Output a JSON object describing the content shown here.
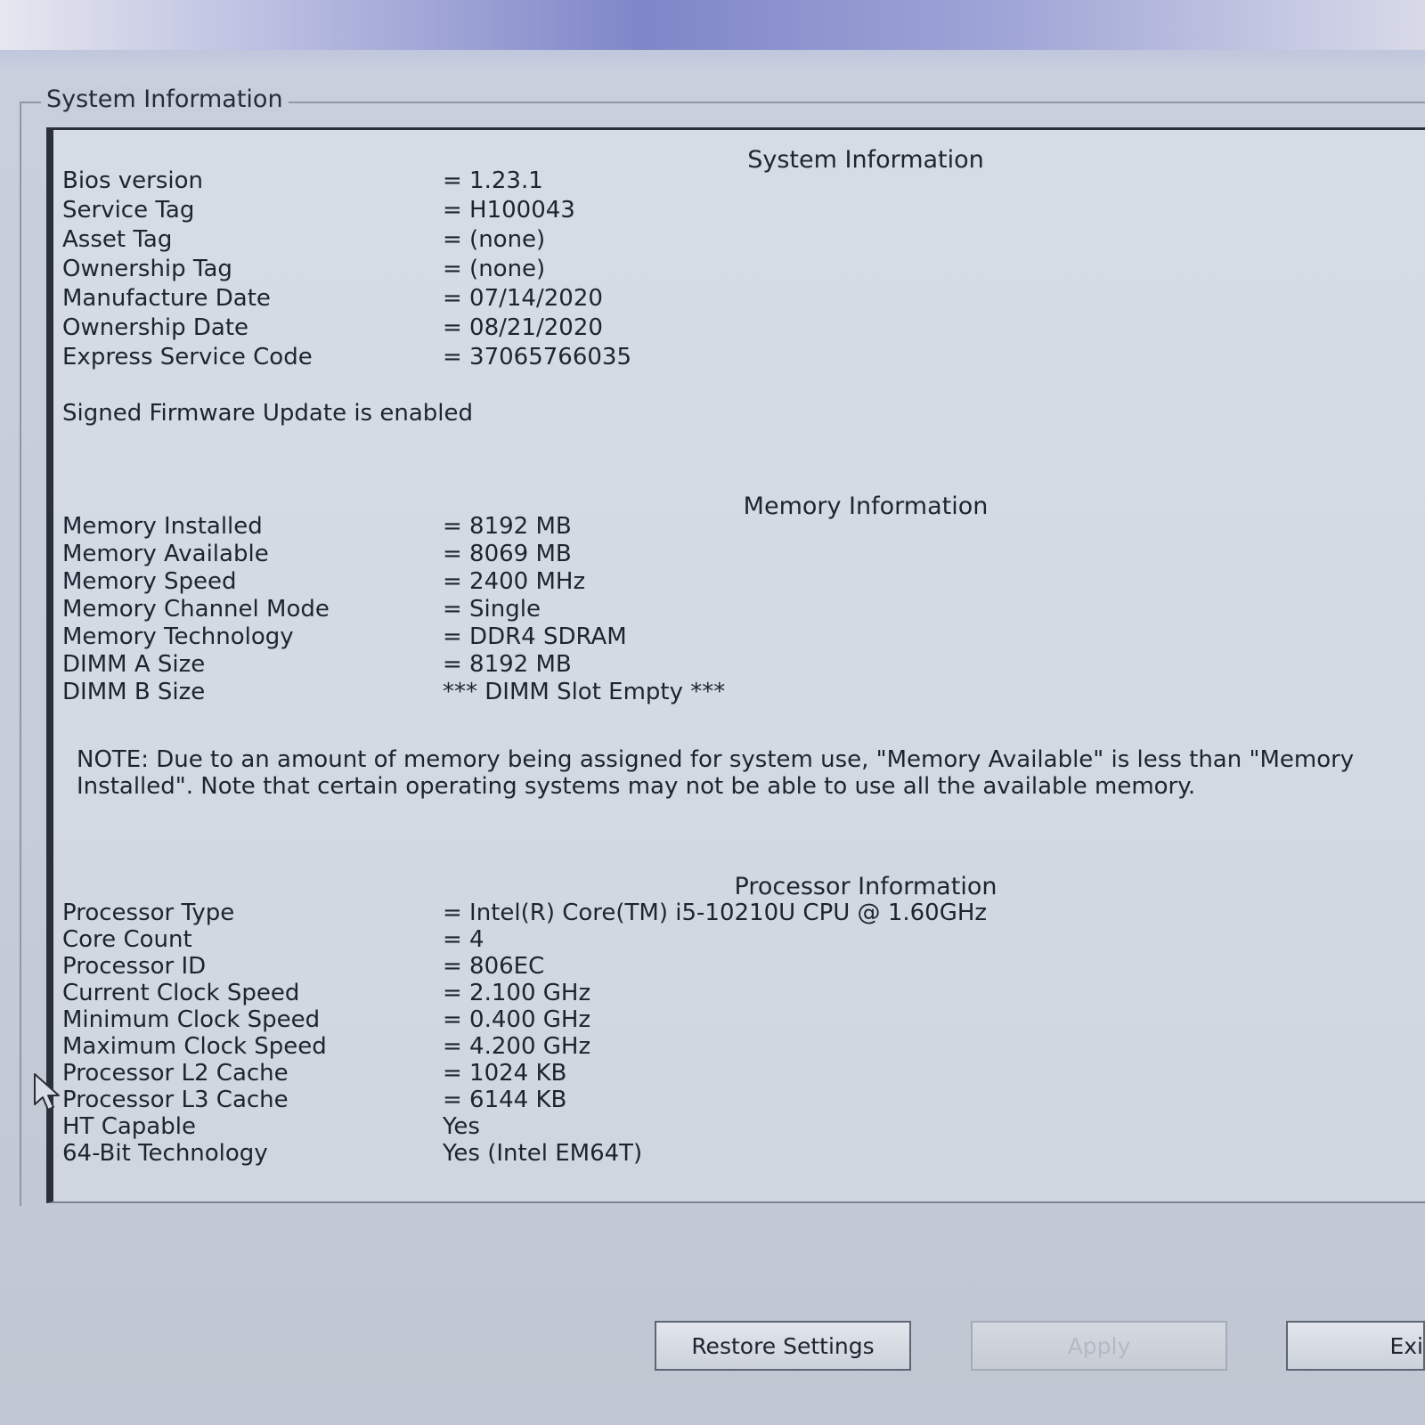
{
  "group_title": "System Information",
  "system": {
    "title": "System Information",
    "rows": [
      {
        "label": "Bios version",
        "value": "= 1.23.1"
      },
      {
        "label": "Service Tag",
        "value": "= H100043"
      },
      {
        "label": "Asset Tag",
        "value": "= (none)"
      },
      {
        "label": "Ownership Tag",
        "value": "= (none)"
      },
      {
        "label": "Manufacture Date",
        "value": "= 07/14/2020"
      },
      {
        "label": "Ownership Date",
        "value": "= 08/21/2020"
      },
      {
        "label": "Express Service Code",
        "value": "= 37065766035"
      }
    ],
    "firmware_note": "Signed Firmware Update is enabled"
  },
  "memory": {
    "title": "Memory Information",
    "rows": [
      {
        "label": "Memory Installed",
        "value": "= 8192 MB"
      },
      {
        "label": "Memory Available",
        "value": "= 8069 MB"
      },
      {
        "label": "Memory Speed",
        "value": "= 2400 MHz"
      },
      {
        "label": "Memory Channel Mode",
        "value": "= Single"
      },
      {
        "label": "Memory Technology",
        "value": "= DDR4 SDRAM"
      },
      {
        "label": "DIMM A Size",
        "value": "= 8192 MB"
      },
      {
        "label": "DIMM B Size",
        "value": "*** DIMM Slot Empty ***"
      }
    ],
    "note": "NOTE: Due to an amount of memory being assigned for system use, \"Memory Available\" is less than \"Memory Installed\". Note that certain operating systems may not be able to use all the available memory."
  },
  "processor": {
    "title": "Processor Information",
    "rows": [
      {
        "label": "Processor Type",
        "value": "= Intel(R) Core(TM) i5-10210U CPU @ 1.60GHz"
      },
      {
        "label": "Core Count",
        "value": "= 4"
      },
      {
        "label": "Processor ID",
        "value": "= 806EC"
      },
      {
        "label": "Current Clock Speed",
        "value": "= 2.100 GHz"
      },
      {
        "label": "Minimum Clock Speed",
        "value": "= 0.400 GHz"
      },
      {
        "label": "Maximum Clock Speed",
        "value": "= 4.200 GHz"
      },
      {
        "label": "Processor L2 Cache",
        "value": "= 1024 KB"
      },
      {
        "label": "Processor L3 Cache",
        "value": "= 6144 KB"
      },
      {
        "label": "HT Capable",
        "value": "Yes"
      },
      {
        "label": "64-Bit Technology",
        "value": "Yes (Intel EM64T)"
      }
    ]
  },
  "buttons": {
    "restore": "Restore Settings",
    "apply": "Apply",
    "exit": "Exi"
  }
}
